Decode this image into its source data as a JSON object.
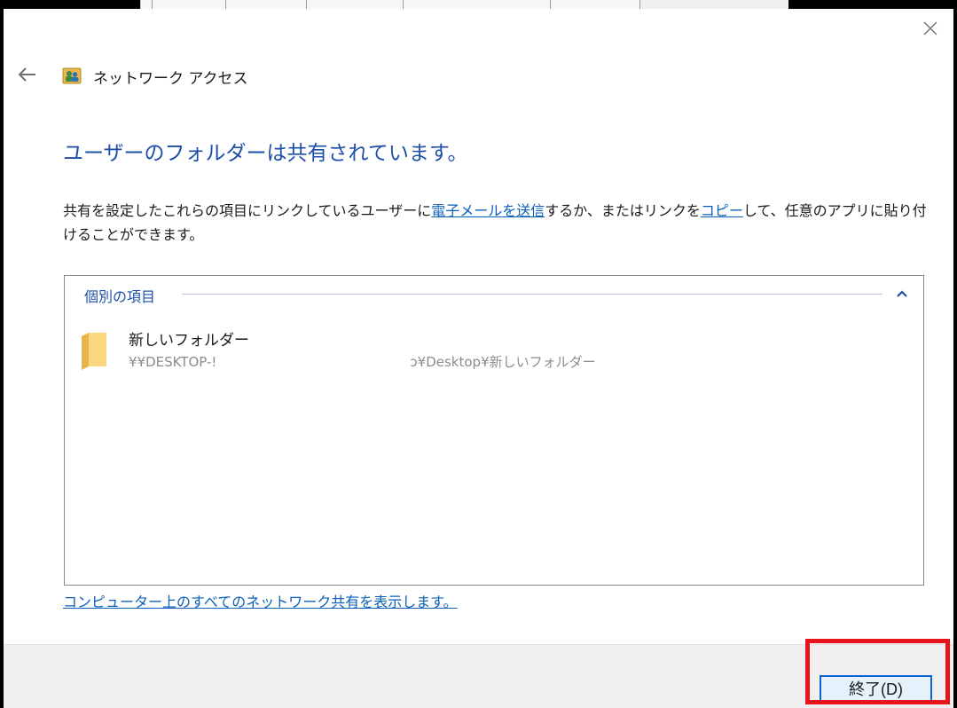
{
  "window": {
    "title": "ネットワーク アクセス"
  },
  "heading": "ユーザーのフォルダーは共有されています。",
  "description": {
    "part1": "共有を設定したこれらの項目にリンクしているユーザーに",
    "email_link": "電子メールを送信",
    "part2": "するか、またはリンクを",
    "copy_link": "コピー",
    "part3": "して、任意のアプリに貼り付けることができます。"
  },
  "items_group": {
    "header": "個別の項目",
    "items": [
      {
        "name": "新しいフォルダー",
        "path_start": "¥¥DESKTOP-!",
        "path_end": "ɔ¥Desktop¥新しいフォルダー"
      }
    ]
  },
  "show_all_link": "コンピューター上のすべてのネットワーク共有を表示します。",
  "buttons": {
    "finish": "終了(D)"
  },
  "icons": {
    "close": "close-icon",
    "back": "back-arrow-icon",
    "network": "network-users-icon",
    "collapse": "chevron-up-icon",
    "folder": "folder-icon"
  },
  "colors": {
    "heading": "#1e4fa8",
    "link": "#0b5fb8",
    "highlight": "#e8141c",
    "button_border": "#0a64d6",
    "button_fill": "#e5f1fb"
  }
}
